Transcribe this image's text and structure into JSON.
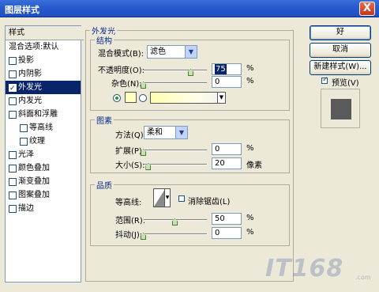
{
  "window": {
    "title": "图层样式",
    "close_label": "X"
  },
  "style_list": {
    "header": "样式",
    "items": [
      {
        "label": "混合选项:默认",
        "checkbox": false,
        "checked": false,
        "selected": false
      },
      {
        "label": "投影",
        "checkbox": true,
        "checked": false,
        "selected": false
      },
      {
        "label": "内阴影",
        "checkbox": true,
        "checked": false,
        "selected": false
      },
      {
        "label": "外发光",
        "checkbox": true,
        "checked": true,
        "selected": true
      },
      {
        "label": "内发光",
        "checkbox": true,
        "checked": false,
        "selected": false
      },
      {
        "label": "斜面和浮雕",
        "checkbox": true,
        "checked": false,
        "selected": false
      },
      {
        "label": "等高线",
        "checkbox": true,
        "checked": false,
        "selected": false
      },
      {
        "label": "纹理",
        "checkbox": true,
        "checked": false,
        "selected": false
      },
      {
        "label": "光泽",
        "checkbox": true,
        "checked": false,
        "selected": false
      },
      {
        "label": "颜色叠加",
        "checkbox": true,
        "checked": false,
        "selected": false
      },
      {
        "label": "渐变叠加",
        "checkbox": true,
        "checked": false,
        "selected": false
      },
      {
        "label": "图案叠加",
        "checkbox": true,
        "checked": false,
        "selected": false
      },
      {
        "label": "描边",
        "checkbox": true,
        "checked": false,
        "selected": false
      }
    ]
  },
  "outer_glow": {
    "title": "外发光",
    "structure": {
      "title": "结构",
      "blend_mode_label": "混合模式(B):",
      "blend_mode_value": "滤色",
      "opacity_label": "不透明度(O):",
      "opacity_value": "75",
      "opacity_unit": "%",
      "noise_label": "杂色(N):",
      "noise_value": "0",
      "noise_unit": "%",
      "opacity_level": 0.75,
      "noise_level": 0.0
    },
    "elements": {
      "title": "图素",
      "technique_label": "方法(Q):",
      "technique_value": "柔和",
      "spread_label": "扩展(P):",
      "spread_value": "0",
      "spread_unit": "%",
      "size_label": "大小(S):",
      "size_value": "20",
      "size_unit": "像素",
      "spread_level": 0.0,
      "size_level": 0.08
    },
    "quality": {
      "title": "品质",
      "contour_label": "等高线:",
      "anti_alias_label": "消除锯齿(L)",
      "range_label": "范围(R):",
      "range_value": "50",
      "range_unit": "%",
      "jitter_label": "抖动(J):",
      "jitter_value": "0",
      "jitter_unit": "%",
      "range_level": 0.5,
      "jitter_level": 0.0
    },
    "colors": {
      "swatch": "#ffffc0"
    }
  },
  "buttons": {
    "ok_label": "好",
    "cancel_label": "取消",
    "new_style_label": "新建样式(W)...",
    "preview_label": "预览(V)"
  },
  "watermark": {
    "text": "IT168",
    "sub": ".com"
  }
}
